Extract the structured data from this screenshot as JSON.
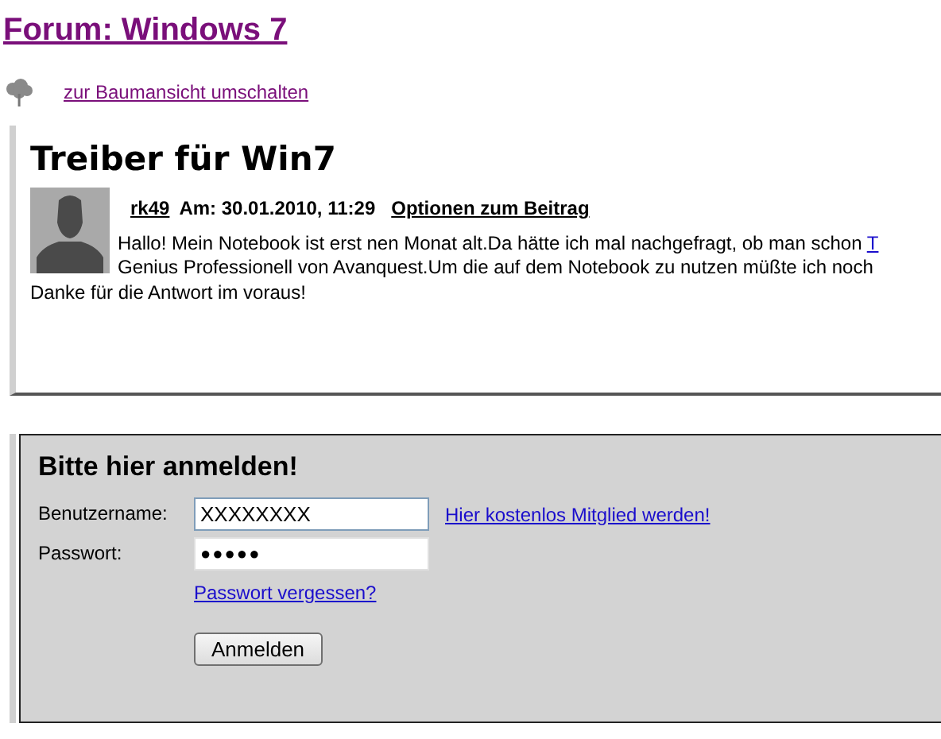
{
  "forum_title": "Forum: Windows 7",
  "tree_view_link": "zur Baumansicht umschalten",
  "post": {
    "title": "Treiber für Win7",
    "author": "rk49",
    "date": "Am: 30.01.2010, 11:29",
    "options_link": "Optionen zum Beitrag",
    "body_lines": [
      {
        "text": "Hallo! Mein Notebook ist erst nen Monat alt.Da hätte ich mal nachgefragt, ob man schon ",
        "link": "T"
      },
      {
        "text": "Genius Professionell von Avanquest.Um die auf dem Notebook zu nutzen müßte ich noch"
      }
    ],
    "closing": "Danke für die Antwort im voraus!"
  },
  "login": {
    "title": "Bitte hier anmelden!",
    "username_label": "Benutzername:",
    "username_value": "XXXXXXXX",
    "register_link": "Hier kostenlos Mitglied werden!",
    "password_label": "Passwort:",
    "password_value": "●●●●●",
    "forgot_link": "Passwort vergessen?",
    "submit": "Anmelden"
  }
}
